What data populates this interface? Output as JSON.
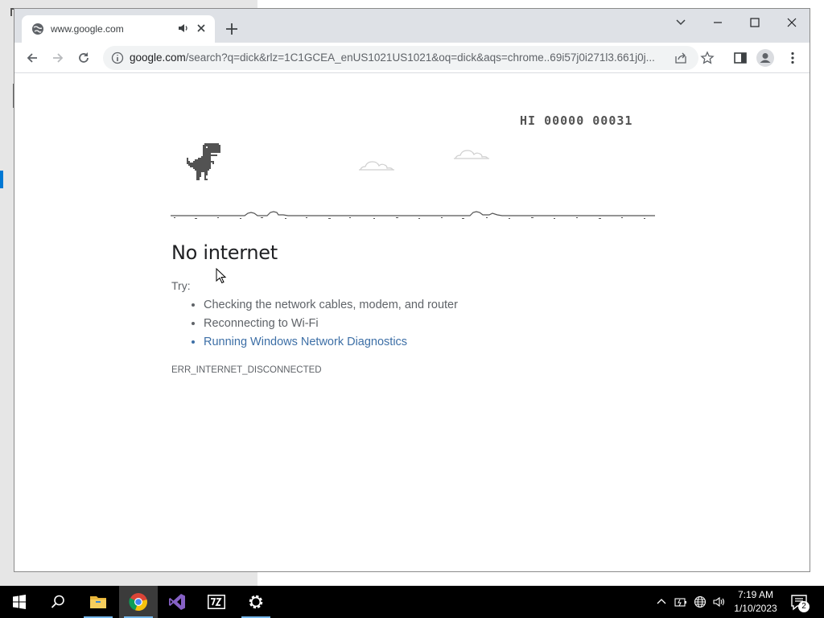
{
  "browser": {
    "tab": {
      "title": "www.google.com"
    },
    "address": {
      "host": "google.com",
      "path": "/search?q=dick&rlz=1C1GCEA_enUS1021US1021&oq=dick&aqs=chrome..69i57j0i271l3.661j0j..."
    }
  },
  "page": {
    "game": {
      "high_score": "HI 00000 00031"
    },
    "heading": "No internet",
    "try_label": "Try:",
    "suggestions": [
      "Checking the network cables, modem, and router",
      "Reconnecting to Wi-Fi",
      "Running Windows Network Diagnostics"
    ],
    "error_code": "ERR_INTERNET_DISCONNECTED"
  },
  "taskbar": {
    "items": [
      "start-icon",
      "search-icon",
      "file-explorer-icon",
      "chrome-icon",
      "visual-studio-icon",
      "7zip-icon",
      "settings-icon"
    ],
    "active": "chrome-icon",
    "clock": {
      "time": "7:19 AM",
      "date": "1/10/2023"
    },
    "notification_count": "2"
  },
  "colors": {
    "link": "#3d6fa6",
    "taskbar": "#000000",
    "tab_strip": "#dee1e6",
    "omnibox": "#f1f3f4"
  }
}
